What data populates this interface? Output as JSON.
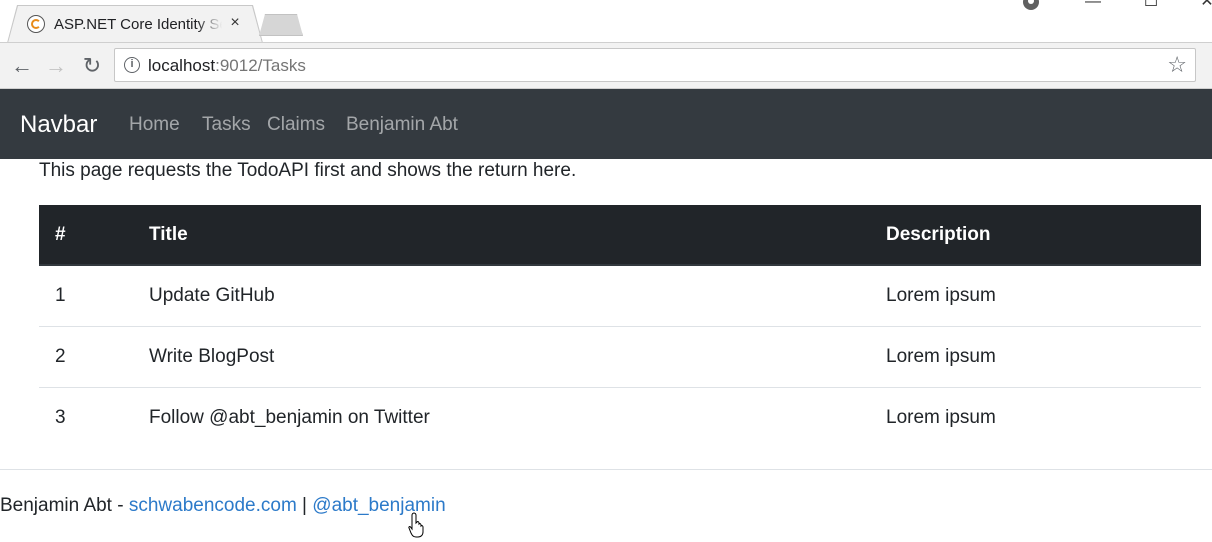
{
  "browser": {
    "tab_title": "ASP.NET Core Identity Se",
    "tab_close": "×",
    "back_icon": "←",
    "forward_icon": "→",
    "reload_icon": "↻",
    "url_host": "localhost",
    "url_rest": ":9012/Tasks",
    "star_icon": "☆",
    "info_icon": "i",
    "window_minimize": "—",
    "window_maximize": "☐",
    "window_close": "✕"
  },
  "navbar": {
    "brand": "Navbar",
    "links": [
      "Home",
      "Tasks",
      "Claims",
      "Benjamin Abt"
    ]
  },
  "page": {
    "intro": "This page requests the TodoAPI first and shows the return here.",
    "table": {
      "headers": [
        "#",
        "Title",
        "Description"
      ],
      "rows": [
        [
          "1",
          "Update GitHub",
          "Lorem ipsum"
        ],
        [
          "2",
          "Write BlogPost",
          "Lorem ipsum"
        ],
        [
          "3",
          "Follow @abt_benjamin on Twitter",
          "Lorem ipsum"
        ]
      ]
    }
  },
  "footer": {
    "prefix": "Benjamin Abt - ",
    "link1": "schwabencode.com",
    "separator": " | ",
    "link2": "@abt_benjamin"
  },
  "colors": {
    "navbar_bg": "#343a40",
    "table_header_bg": "#212529",
    "link": "#2c7ac9"
  }
}
